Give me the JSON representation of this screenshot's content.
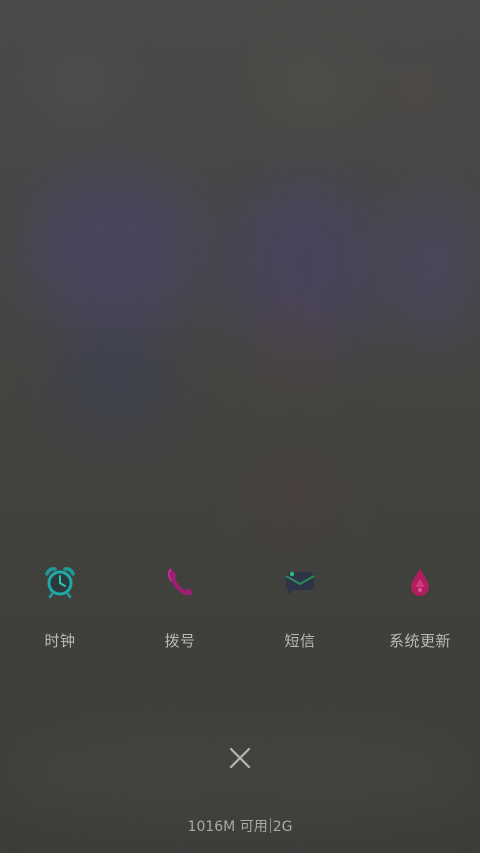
{
  "recent_apps": [
    {
      "label": "时钟",
      "icon": "alarm-clock-icon"
    },
    {
      "label": "拨号",
      "icon": "phone-icon"
    },
    {
      "label": "短信",
      "icon": "message-icon"
    },
    {
      "label": "系统更新",
      "icon": "update-drop-icon"
    }
  ],
  "close_all": {
    "icon": "close-icon"
  },
  "memory": {
    "available": "1016M 可用",
    "total": "2G"
  }
}
